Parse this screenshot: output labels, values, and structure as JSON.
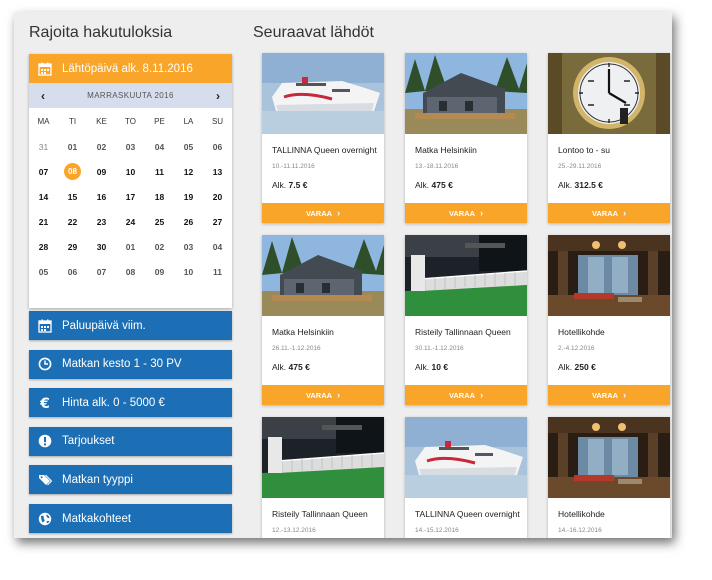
{
  "sidebar": {
    "title": "Rajoita hakutuloksia",
    "departure": "Lähtöpäivä alk. 8.11.2016",
    "month": "MARRASKUUTA 2016",
    "prev": "‹",
    "next": "›",
    "weekdays": [
      "MA",
      "TI",
      "KE",
      "TO",
      "PE",
      "LA",
      "SU"
    ],
    "days": [
      "31",
      "01",
      "02",
      "03",
      "04",
      "05",
      "06",
      "07",
      "08",
      "09",
      "10",
      "11",
      "12",
      "13",
      "14",
      "15",
      "16",
      "17",
      "18",
      "19",
      "20",
      "21",
      "22",
      "23",
      "24",
      "25",
      "26",
      "27",
      "28",
      "29",
      "30",
      "01",
      "02",
      "03",
      "04",
      "05",
      "06",
      "07",
      "08",
      "09",
      "10",
      "11"
    ],
    "selected_day": "08",
    "filters": [
      {
        "label": "Paluupäivä viim.",
        "icon": "calendar-icon"
      },
      {
        "label": "Matkan kesto 1 - 30 PV",
        "icon": "clock-icon"
      },
      {
        "label": "Hinta alk. 0 - 5000 €",
        "icon": "euro-icon"
      },
      {
        "label": "Tarjoukset",
        "icon": "exclamation-icon"
      },
      {
        "label": "Matkan tyyppi",
        "icon": "tags-icon"
      },
      {
        "label": "Matkakohteet",
        "icon": "globe-icon"
      }
    ]
  },
  "main": {
    "title": "Seuraavat lähdöt",
    "price_prefix": "Alk.",
    "book_label": "VARAA",
    "cards": [
      {
        "title": "TALLINNA Queen overnight",
        "dates": "10.-11.11.2016",
        "price": "7.5 €",
        "image": "ferry"
      },
      {
        "title": "Matka Helsinkiin",
        "dates": "13.-18.11.2016",
        "price": "475 €",
        "image": "cabin"
      },
      {
        "title": "Lontoo to - su",
        "dates": "25.-29.11.2016",
        "price": "312.5 €",
        "image": "clock"
      },
      {
        "title": "Matka Helsinkiin",
        "dates": "26.11.-1.12.2016",
        "price": "475 €",
        "image": "cabin"
      },
      {
        "title": "Risteily Tallinnaan Queen",
        "dates": "30.11.-1.12.2016",
        "price": "10 €",
        "image": "deck"
      },
      {
        "title": "Hotellikohde",
        "dates": "2.-4.12.2016",
        "price": "250 €",
        "image": "lobby"
      },
      {
        "title": "Risteily Tallinnaan Queen",
        "dates": "12.-13.12.2016",
        "price": "",
        "image": "deck"
      },
      {
        "title": "TALLINNA Queen overnight",
        "dates": "14.-15.12.2016",
        "price": "",
        "image": "ferry"
      },
      {
        "title": "Hotellikohde",
        "dates": "14.-16.12.2016",
        "price": "",
        "image": "lobby"
      }
    ]
  }
}
